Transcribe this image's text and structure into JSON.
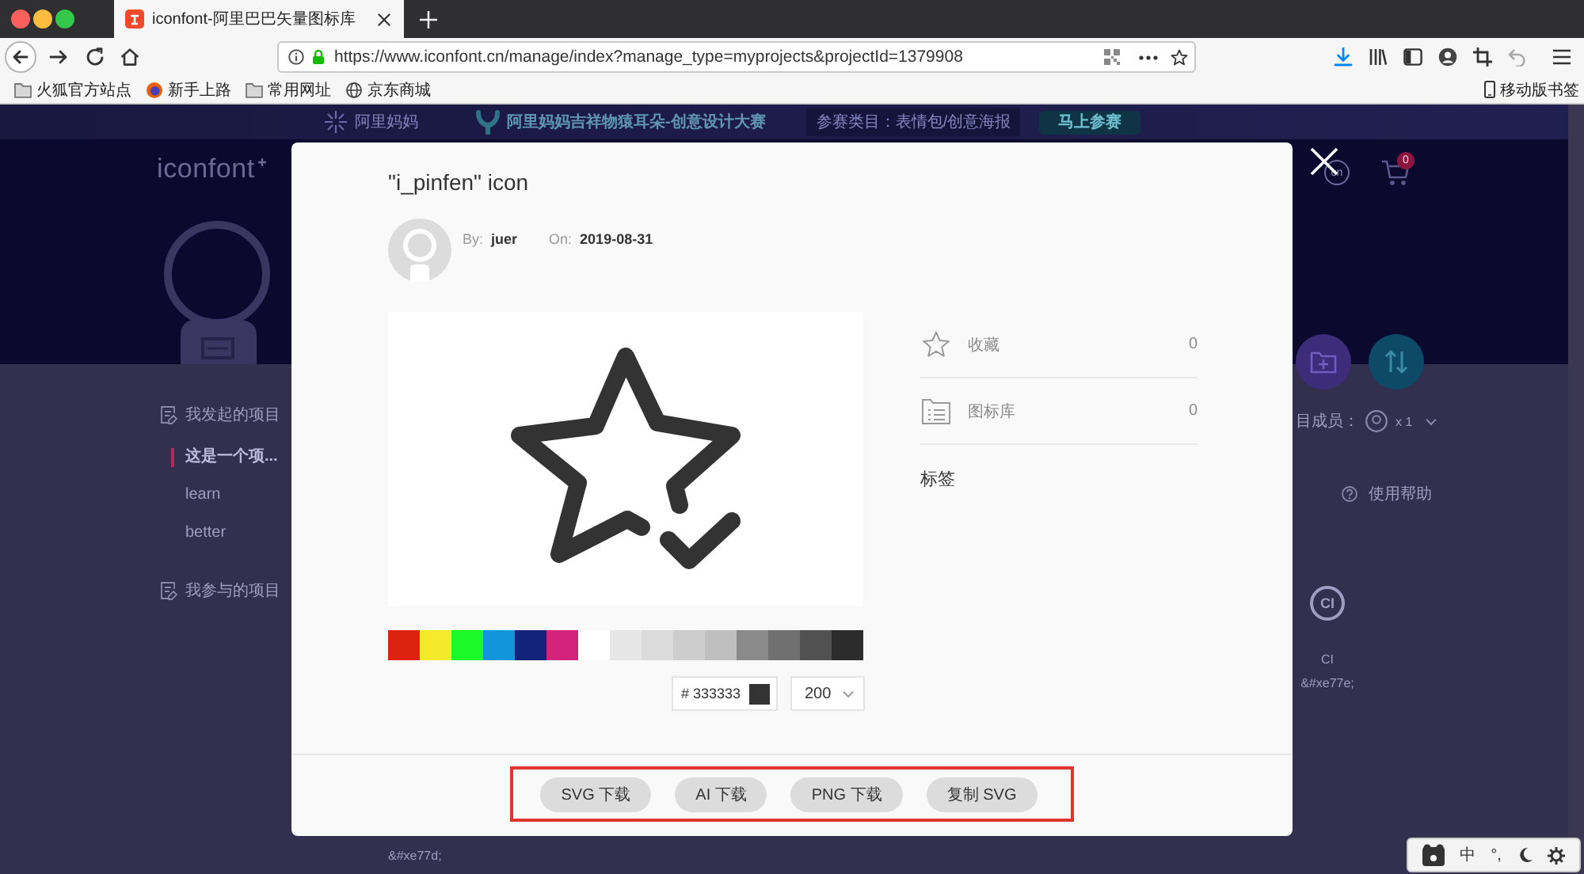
{
  "browser": {
    "tabs": [
      {
        "title": "iconfont-阿里巴巴矢量图标库",
        "selected": true
      }
    ],
    "url": "https://www.iconfont.cn/manage/index?manage_type=myprojects&projectId=1379908",
    "bookmarks": [
      {
        "label": "火狐官方站点",
        "kind": "folder"
      },
      {
        "label": "新手上路",
        "kind": "firefox"
      },
      {
        "label": "常用网址",
        "kind": "folder"
      },
      {
        "label": "京东商城",
        "kind": "globe"
      }
    ],
    "mobile_bookmarks": "移动版书签"
  },
  "page": {
    "banner": {
      "brand": "阿里妈妈",
      "title": "阿里妈妈吉祥物猿耳朵-创意设计大赛",
      "category": "参赛类目：表情包/创意海报",
      "button": "马上参赛"
    },
    "logo": "iconfont",
    "header": {
      "language": "cn",
      "cart_count": "0"
    },
    "sidebar": [
      {
        "title": "我发起的项目",
        "items": [
          {
            "label": "这是一个项...",
            "selected": true
          },
          {
            "label": "learn",
            "selected": false
          },
          {
            "label": "better",
            "selected": false
          }
        ]
      },
      {
        "title": "我参与的项目"
      }
    ],
    "members": {
      "label": "目成员：",
      "count": "x 1"
    },
    "help": "使用帮助",
    "icon_cards": [
      {
        "glyph": "CI",
        "name": "CI",
        "code": "&#xe77e;"
      }
    ],
    "lower_code": "&#xe77d;"
  },
  "modal": {
    "title": "\"i_pinfen\" icon",
    "author_label": "By:",
    "author": "juer",
    "date_label": "On:",
    "date": "2019-08-31",
    "swatches": [
      {
        "color": "#dd2211"
      },
      {
        "color": "#f4ea2a"
      },
      {
        "color": "#1afa29"
      },
      {
        "color": "#1296db"
      },
      {
        "color": "#13227a"
      },
      {
        "color": "#d4237a"
      },
      {
        "color": "#ffffff"
      },
      {
        "color": "#e6e6e6"
      },
      {
        "color": "#dbdbdb"
      },
      {
        "color": "#cdcdcd"
      },
      {
        "color": "#bfbfbf"
      },
      {
        "color": "#8a8a8a"
      },
      {
        "color": "#707070"
      },
      {
        "color": "#515151"
      },
      {
        "color": "#2c2c2c"
      }
    ],
    "color_prefix": "#",
    "color_value": "333333",
    "size": "200",
    "stats": [
      {
        "kind": "favorite",
        "label": "收藏",
        "count": "0"
      },
      {
        "kind": "library",
        "label": "图标库",
        "count": "0"
      }
    ],
    "tags_label": "标签",
    "buttons": [
      "SVG 下载",
      "AI 下载",
      "PNG 下载",
      "复制 SVG"
    ]
  },
  "input_method": {
    "mode": "中",
    "punctuation": "°,"
  }
}
